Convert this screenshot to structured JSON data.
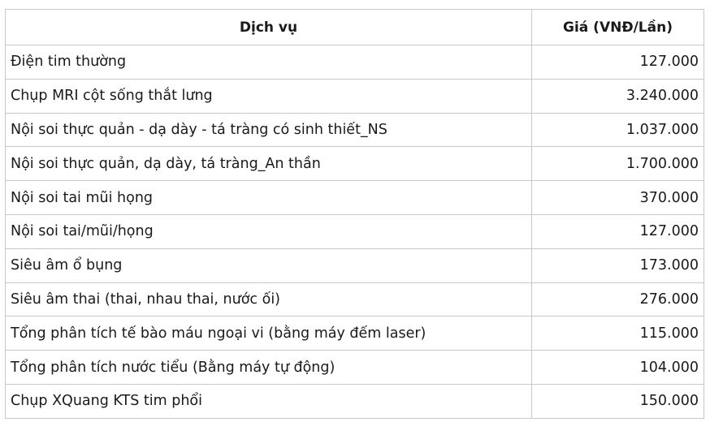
{
  "table": {
    "headers": {
      "service": "Dịch vụ",
      "price": "Giá (VNĐ/Lần)"
    },
    "rows": [
      {
        "service": "Điện tim thường",
        "price": "127.000"
      },
      {
        "service": "Chụp MRI cột sống thắt lưng",
        "price": "3.240.000"
      },
      {
        "service": "Nội soi thực quản - dạ dày - tá tràng có sinh thiết_NS",
        "price": "1.037.000"
      },
      {
        "service": "Nội soi thực quản, dạ dày, tá tràng_An thần",
        "price": "1.700.000"
      },
      {
        "service": "Nội soi tai mũi họng",
        "price": "370.000"
      },
      {
        "service": "Nội soi tai/mũi/họng",
        "price": "127.000"
      },
      {
        "service": "Siêu âm ổ bụng",
        "price": "173.000"
      },
      {
        "service": "Siêu âm thai (thai, nhau thai, nước ối)",
        "price": "276.000"
      },
      {
        "service": "Tổng phân tích tế bào máu ngoại vi (bằng máy đếm laser)",
        "price": "115.000"
      },
      {
        "service": "Tổng phân tích nước tiểu (Bằng máy tự động)",
        "price": "104.000"
      },
      {
        "service": "Chụp XQuang KTS tim phổi",
        "price": "150.000"
      }
    ]
  }
}
